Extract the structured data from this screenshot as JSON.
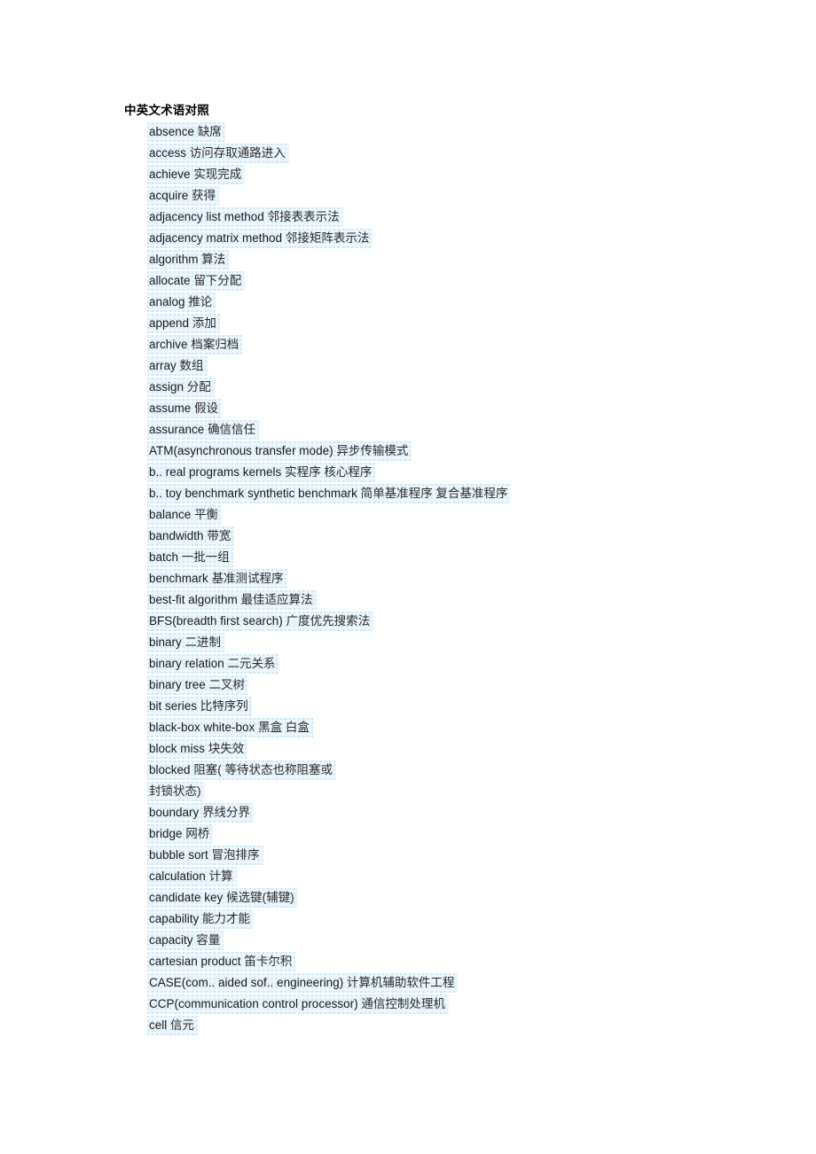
{
  "document": {
    "title": "中英文术语对照",
    "page_background": "#ffffff",
    "highlight_color": "#eff6fb",
    "text_color": "#1a1a1a",
    "entries": [
      {
        "term": "absence",
        "meaning": "缺席",
        "wrapped": false
      },
      {
        "term": "access",
        "meaning": "访问存取通路进入",
        "wrapped": false
      },
      {
        "term": "achieve",
        "meaning": "实现完成",
        "wrapped": false
      },
      {
        "term": "acquire",
        "meaning": "获得",
        "wrapped": false
      },
      {
        "term": "adjacency list method",
        "meaning": "邻接表表示法",
        "wrapped": false
      },
      {
        "term": "adjacency matrix method",
        "meaning": "邻接矩阵表示法",
        "wrapped": false
      },
      {
        "term": "algorithm",
        "meaning": "算法",
        "wrapped": false
      },
      {
        "term": "allocate",
        "meaning": "留下分配",
        "wrapped": false
      },
      {
        "term": "analog",
        "meaning": "推论",
        "wrapped": false
      },
      {
        "term": "append",
        "meaning": "添加",
        "wrapped": false
      },
      {
        "term": "archive",
        "meaning": "档案归档",
        "wrapped": false
      },
      {
        "term": "array",
        "meaning": "数组",
        "wrapped": false
      },
      {
        "term": "assign",
        "meaning": "分配",
        "wrapped": false
      },
      {
        "term": "assume",
        "meaning": "假设",
        "wrapped": false
      },
      {
        "term": "assurance",
        "meaning": "确信信任",
        "wrapped": false
      },
      {
        "term": "ATM(asynchronous transfer mode)",
        "meaning": "异步传输模式",
        "wrapped": false
      },
      {
        "term": "b.. real programs kernels",
        "meaning": "实程序 核心程序",
        "wrapped": false
      },
      {
        "term": "b.. toy benchmark synthetic benchmark",
        "meaning": "简单基准程序 复合基准程序",
        "wrapped": false
      },
      {
        "term": "balance",
        "meaning": "平衡",
        "wrapped": false
      },
      {
        "term": "bandwidth",
        "meaning": "带宽",
        "wrapped": false
      },
      {
        "term": "batch",
        "meaning": "一批一组",
        "wrapped": false
      },
      {
        "term": "benchmark",
        "meaning": "基准测试程序",
        "wrapped": false
      },
      {
        "term": "best-fit algorithm",
        "meaning": "最佳适应算法",
        "wrapped": false
      },
      {
        "term": "BFS(breadth first search)",
        "meaning": "广度优先搜索法",
        "wrapped": false
      },
      {
        "term": "binary",
        "meaning": "二进制",
        "wrapped": false
      },
      {
        "term": "binary relation",
        "meaning": "二元关系",
        "wrapped": false
      },
      {
        "term": "binary tree",
        "meaning": "二叉树",
        "wrapped": false
      },
      {
        "term": "bit series",
        "meaning": "比特序列",
        "wrapped": false
      },
      {
        "term": "black-box white-box",
        "meaning": "黑盒 白盒",
        "wrapped": false
      },
      {
        "term": "block miss",
        "meaning": "块失效",
        "wrapped": false
      },
      {
        "term": "blocked",
        "meaning": "阻塞( 等待状态也称阻塞或",
        "wrapped": true,
        "continuation": "封锁状态)"
      },
      {
        "term": "boundary",
        "meaning": "界线分界",
        "wrapped": false
      },
      {
        "term": "bridge",
        "meaning": "网桥",
        "wrapped": false
      },
      {
        "term": "bubble sort",
        "meaning": "冒泡排序",
        "wrapped": false
      },
      {
        "term": "calculation",
        "meaning": "计算",
        "wrapped": false
      },
      {
        "term": "candidate key",
        "meaning": "候选键(辅键)",
        "wrapped": false
      },
      {
        "term": "capability",
        "meaning": "能力才能",
        "wrapped": false
      },
      {
        "term": "capacity",
        "meaning": "容量",
        "wrapped": false
      },
      {
        "term": "cartesian product",
        "meaning": "笛卡尔积",
        "wrapped": false
      },
      {
        "term": "CASE(com.. aided sof.. engineering)",
        "meaning": "计算机辅助软件工程",
        "wrapped": false
      },
      {
        "term": "CCP(communication control processor)",
        "meaning": "通信控制处理机",
        "wrapped": false
      },
      {
        "term": "cell",
        "meaning": "信元",
        "wrapped": false
      }
    ]
  }
}
